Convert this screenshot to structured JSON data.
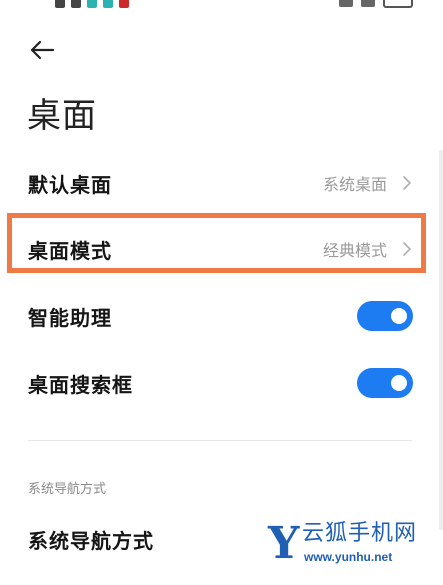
{
  "page": {
    "title": "桌面",
    "back_icon": "arrow-left-icon"
  },
  "settings": [
    {
      "label": "默认桌面",
      "value": "系统桌面",
      "type": "link"
    },
    {
      "label": "桌面模式",
      "value": "经典模式",
      "type": "link",
      "highlighted": true
    },
    {
      "label": "智能助理",
      "type": "toggle",
      "enabled": true
    },
    {
      "label": "桌面搜索框",
      "type": "toggle",
      "enabled": true
    }
  ],
  "section": {
    "header": "系统导航方式",
    "items": [
      {
        "label": "系统导航方式"
      }
    ]
  },
  "watermark": {
    "name": "云狐手机网",
    "url": "www.yunhu.net"
  },
  "colors": {
    "accent": "#1e7cf2",
    "highlight": "#f07a45",
    "watermark": "#1f5fb4",
    "secondary_text": "#9a9a9a"
  }
}
